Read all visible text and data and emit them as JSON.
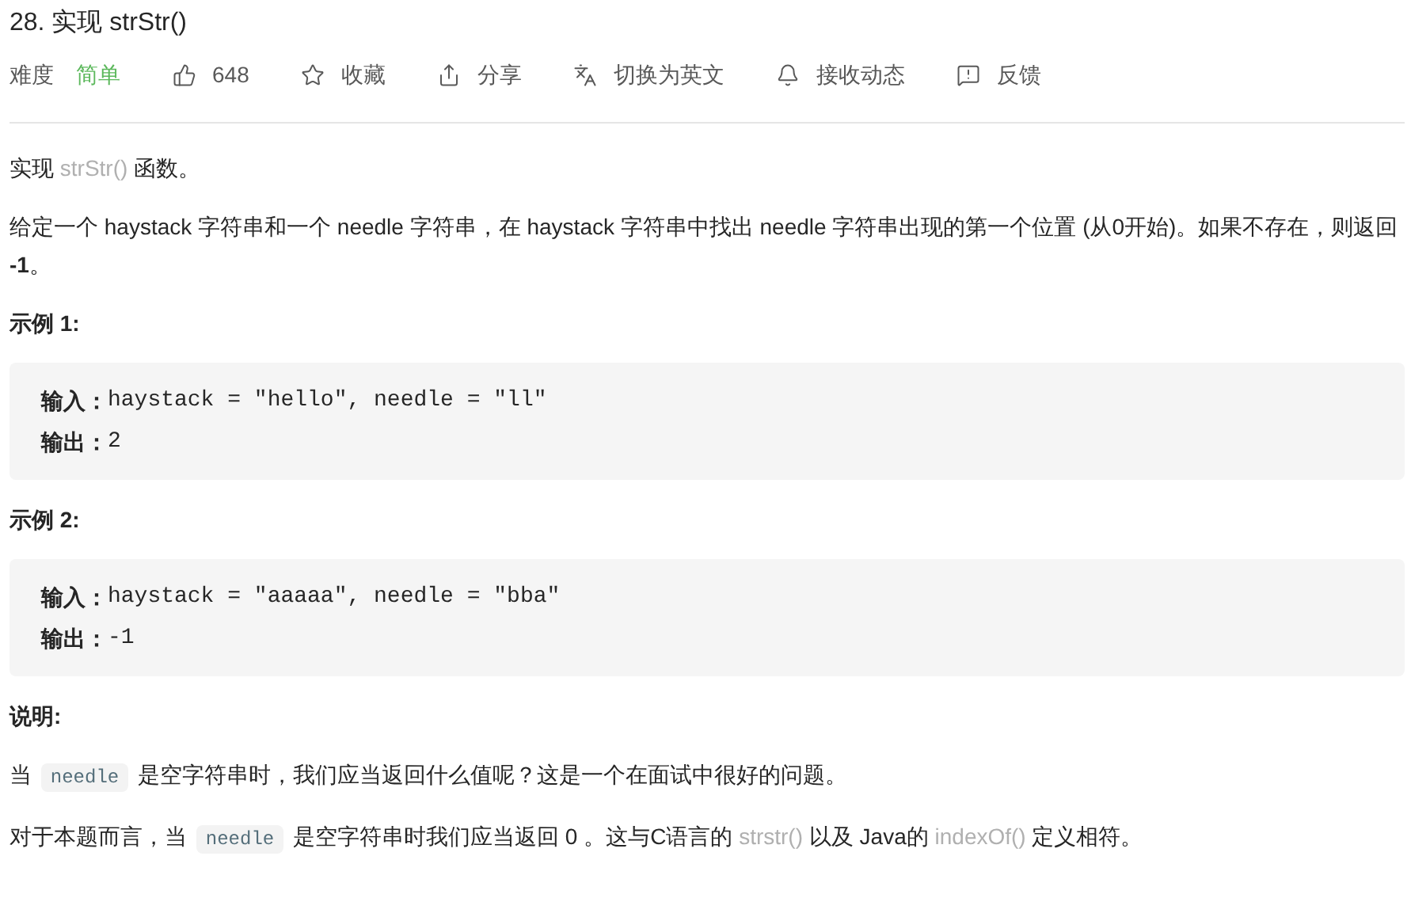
{
  "title": "28. 实现 strStr()",
  "meta": {
    "difficulty_label": "难度",
    "difficulty": "简单",
    "actions": [
      {
        "kind": "like",
        "label": "648"
      },
      {
        "kind": "star",
        "label": "收藏"
      },
      {
        "kind": "share",
        "label": "分享"
      },
      {
        "kind": "translate",
        "label": "切换为英文"
      },
      {
        "kind": "bell",
        "label": "接收动态"
      },
      {
        "kind": "feedback",
        "label": "反馈"
      }
    ]
  },
  "content": [
    {
      "kind": "paragraph",
      "segments": [
        {
          "kind": "text",
          "text": "实现 "
        },
        {
          "kind": "link",
          "text": "strStr()"
        },
        {
          "kind": "text",
          "text": " 函数。"
        }
      ]
    },
    {
      "kind": "paragraph",
      "segments": [
        {
          "kind": "text",
          "text": "给定一个 haystack 字符串和一个 needle 字符串，在 haystack 字符串中找出 needle 字符串出现的第一个位置 (从0开始)。如果不存在，则返回  **-1**。"
        }
      ]
    },
    {
      "kind": "heading",
      "text": "示例 1:"
    },
    {
      "kind": "example",
      "lines": [
        {
          "label": "输入：",
          "code": "haystack = \"hello\", needle = \"ll\""
        },
        {
          "label": "输出：",
          "code": "2"
        }
      ]
    },
    {
      "kind": "heading",
      "text": "示例 2:"
    },
    {
      "kind": "example",
      "lines": [
        {
          "label": "输入：",
          "code": "haystack = \"aaaaa\", needle = \"bba\""
        },
        {
          "label": "输出：",
          "code": "-1"
        }
      ]
    },
    {
      "kind": "heading",
      "text": "说明:"
    },
    {
      "kind": "paragraph",
      "segments": [
        {
          "kind": "text",
          "text": "当 "
        },
        {
          "kind": "code",
          "text": "needle"
        },
        {
          "kind": "text",
          "text": " 是空字符串时，我们应当返回什么值呢？这是一个在面试中很好的问题。"
        }
      ]
    },
    {
      "kind": "paragraph",
      "segments": [
        {
          "kind": "text",
          "text": "对于本题而言，当 "
        },
        {
          "kind": "code",
          "text": "needle"
        },
        {
          "kind": "text",
          "text": " 是空字符串时我们应当返回 0 。这与C语言的 "
        },
        {
          "kind": "link",
          "text": "strstr()"
        },
        {
          "kind": "text",
          "text": " 以及 Java的 "
        },
        {
          "kind": "link",
          "text": "indexOf()"
        },
        {
          "kind": "text",
          "text": " 定义相符。"
        }
      ]
    }
  ]
}
